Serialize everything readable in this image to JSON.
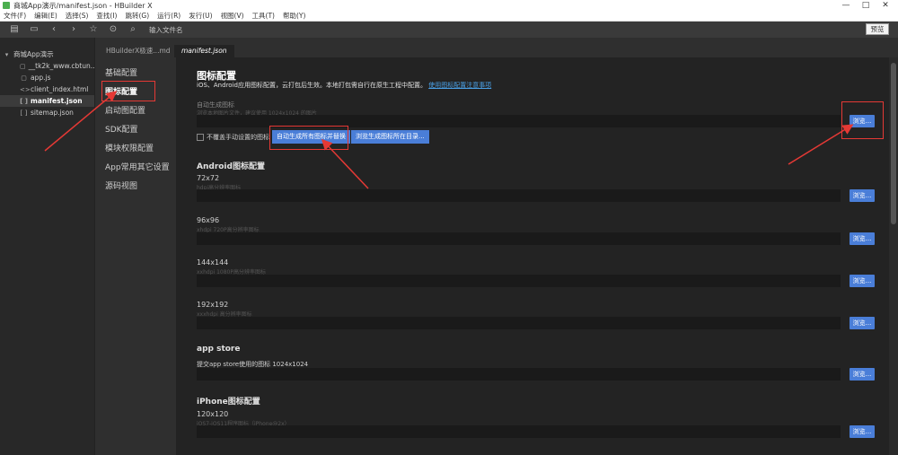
{
  "window": {
    "title": "商城App演示/manifest.json - HBuilder X",
    "minimize": "—",
    "maximize": "□",
    "close": "✕"
  },
  "menu": [
    "文件(F)",
    "编辑(E)",
    "选择(S)",
    "查找(I)",
    "跳转(G)",
    "运行(R)",
    "发行(U)",
    "视图(V)",
    "工具(T)",
    "帮助(Y)"
  ],
  "toolbar": {
    "search_label": "输入文件名",
    "preview_label": "预览"
  },
  "file_tree": [
    {
      "label": "商城App演示",
      "icon": "▾",
      "depth": 0
    },
    {
      "label": "__tk2k_www.cbtun...",
      "icon": "▢",
      "depth": 1
    },
    {
      "label": "app.js",
      "icon": "▢",
      "depth": 1
    },
    {
      "label": "client_index.html",
      "icon": "<>",
      "depth": 1
    },
    {
      "label": "manifest.json",
      "icon": "[ ]",
      "depth": 1
    },
    {
      "label": "sitemap.json",
      "icon": "[ ]",
      "depth": 1
    }
  ],
  "tabs": [
    "HBuilderX极速...md",
    "manifest.json"
  ],
  "settings_nav": [
    "基础配置",
    "图标配置",
    "启动图配置",
    "SDK配置",
    "模块权限配置",
    "App常用其它设置",
    "源码视图"
  ],
  "content": {
    "title": "图标配置",
    "description": "iOS、Android应用图标配置，云打包后生效。本地打包需自行在原生工程中配置。",
    "description_link": "使用图标配置注意事项",
    "auto_label": "自动生成图标",
    "auto_hint": "浏览本地图片文件，建议使用 1024x1024 的图片",
    "checkbox_label": "不覆盖手动设置的图标",
    "auto_generate_btn": "自动生成所有图标并替换",
    "browse_dir_btn": "浏览生成图标所在目录...",
    "browse_label": "浏览...",
    "android_section": "Android图标配置",
    "android_icons": [
      {
        "size": "72x72",
        "hint": "hdpi高分辨率图标"
      },
      {
        "size": "96x96",
        "hint": "xhdpi 720P高分辨率图标"
      },
      {
        "size": "144x144",
        "hint": "xxhdpi 1080P高分辨率图标"
      },
      {
        "size": "192x192",
        "hint": "xxxhdpi 高分辨率图标"
      }
    ],
    "appstore_section": "app store",
    "appstore_hint": "提交app store使用的图标 1024x1024",
    "iphone_section": "iPhone图标配置",
    "iphone_icons": [
      {
        "size": "120x120",
        "hint": "iOS7-iOS11程序图标（iPhone@2x）"
      }
    ]
  },
  "accent_color": "#4a7ed8",
  "annotation_color": "#e53935"
}
